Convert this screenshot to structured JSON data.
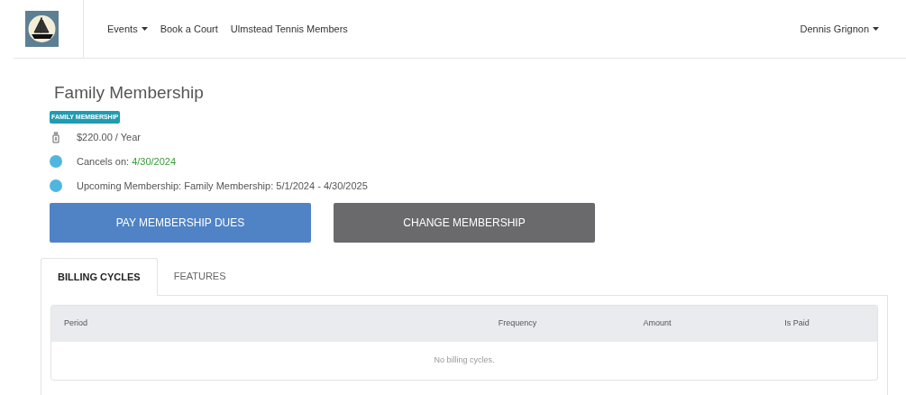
{
  "nav": {
    "items": [
      {
        "label": "Events",
        "dropdown": true
      },
      {
        "label": "Book a Court",
        "dropdown": false
      },
      {
        "label": "Ulmstead Tennis Members",
        "dropdown": false
      }
    ],
    "user": {
      "label": "Dennis Grignon",
      "dropdown": true
    }
  },
  "membership": {
    "title": "Family Membership",
    "badge": "FAMILY MEMBERSHIP",
    "details": [
      {
        "kind": "price",
        "text": "$220.00 / Year"
      },
      {
        "kind": "dot",
        "text": "Cancels on: ",
        "highlight": "4/30/2024"
      },
      {
        "kind": "dot",
        "text": "Upcoming Membership: Family Membership: 5/1/2024 - 4/30/2025"
      }
    ],
    "buttons": [
      {
        "kind": "primary",
        "label": "PAY MEMBERSHIP DUES"
      },
      {
        "kind": "secondary",
        "label": "CHANGE MEMBERSHIP"
      }
    ]
  },
  "tabs": [
    {
      "label": "BILLING CYCLES",
      "selected": true
    },
    {
      "label": "FEATURES",
      "selected": false
    }
  ],
  "table": {
    "columns": [
      "Period",
      "Frequency",
      "Amount",
      "Is Paid"
    ],
    "empty_message": "No billing cycles."
  }
}
